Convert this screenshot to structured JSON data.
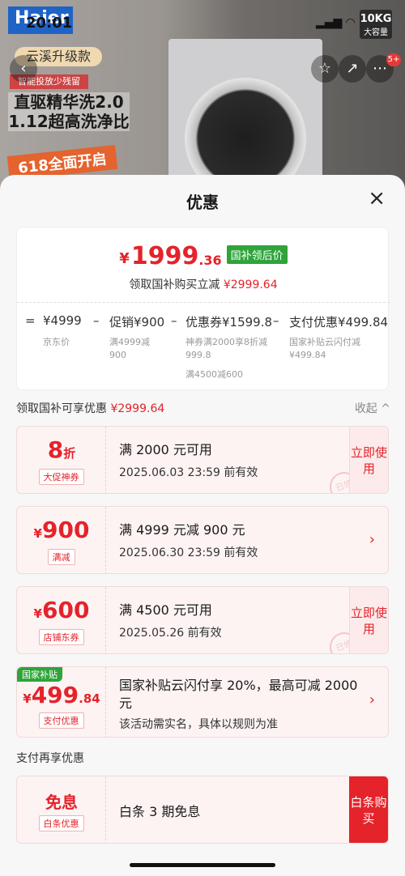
{
  "background": {
    "brand": "Haier",
    "capacity_badge": "10KG",
    "capacity_sub": "大容量",
    "time": "20:01",
    "tag1": "云溪升级款",
    "tag2": "智能投放少残留",
    "promo_line1": "直驱精华洗2.0",
    "promo_line2": "1.12超高洗净比",
    "deal": "618全面开启",
    "cart_badge": "5+",
    "icons": {
      "back": "back-icon",
      "favorite": "star-icon",
      "share": "share-icon",
      "more": "more-icon"
    }
  },
  "sheet": {
    "title": "优惠",
    "close_label": "×"
  },
  "summary": {
    "currency": "¥",
    "price_int": "1999",
    "price_dec": ".36",
    "badge": "国补领后价",
    "sub_text": "领取国补购买立减",
    "sub_amount": "¥2999.64",
    "breakdown": {
      "eq": "=",
      "base": "¥4999",
      "base_label": "京东价",
      "minus1": "–",
      "promo": "促销¥900",
      "promo_label1": "满4999减",
      "promo_label2": "900",
      "minus2": "–",
      "coupon": "优惠券¥1599.8",
      "coupon_label1": "神券满2000享8折减",
      "coupon_label2": "999.8",
      "coupon_label3": "满4500减600",
      "minus3": "–",
      "pay": "支付优惠¥499.84",
      "pay_label1": "国家补贴云闪付减",
      "pay_label2": "¥499.84"
    }
  },
  "section1": {
    "label": "领取国补可享优惠",
    "amount": "¥2999.64",
    "collapse": "收起 ^"
  },
  "cards": [
    {
      "value": "8",
      "unit": "折",
      "tag": "大促神券",
      "main": "满 2000 元可用",
      "date": "2025.06.03 23:59 前有效",
      "action": "立即使用",
      "stamp": "已领"
    },
    {
      "currency": "¥",
      "value": "900",
      "tag": "满减",
      "main": "满 4999 元减 900 元",
      "date": "2025.06.30 23:59 前有效",
      "chev": "›"
    },
    {
      "currency": "¥",
      "value": "600",
      "tag": "店铺东券",
      "main": "满 4500 元可用",
      "date": "2025.05.26 前有效",
      "action": "立即使用",
      "stamp": "已领"
    },
    {
      "gov": "国家补贴",
      "currency": "¥",
      "value": "499",
      "dec": ".84",
      "tag": "支付优惠",
      "main": "国家补贴云闪付享 20%，最高可减 2000 元",
      "date": "该活动需实名，具体以规则为准",
      "chev": "›"
    }
  ],
  "section2": {
    "label": "支付再享优惠"
  },
  "last_card": {
    "value": "免息",
    "tag": "白条优惠",
    "main": "白条 3 期免息",
    "action": "白条购买"
  }
}
